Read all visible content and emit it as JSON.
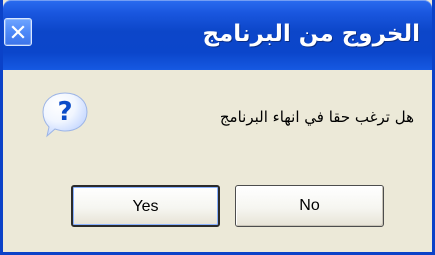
{
  "window": {
    "title": "الخروج من البرنامج",
    "close_icon": "close-icon"
  },
  "dialog": {
    "message": "هل ترغب حقا في انهاء البرنامج",
    "icon": "question-icon",
    "buttons": {
      "yes_label": "Yes",
      "no_label": "No"
    }
  },
  "colors": {
    "titlebar": "#0b46cb",
    "window_bg": "#ece9d8",
    "border": "#0b42c8"
  }
}
